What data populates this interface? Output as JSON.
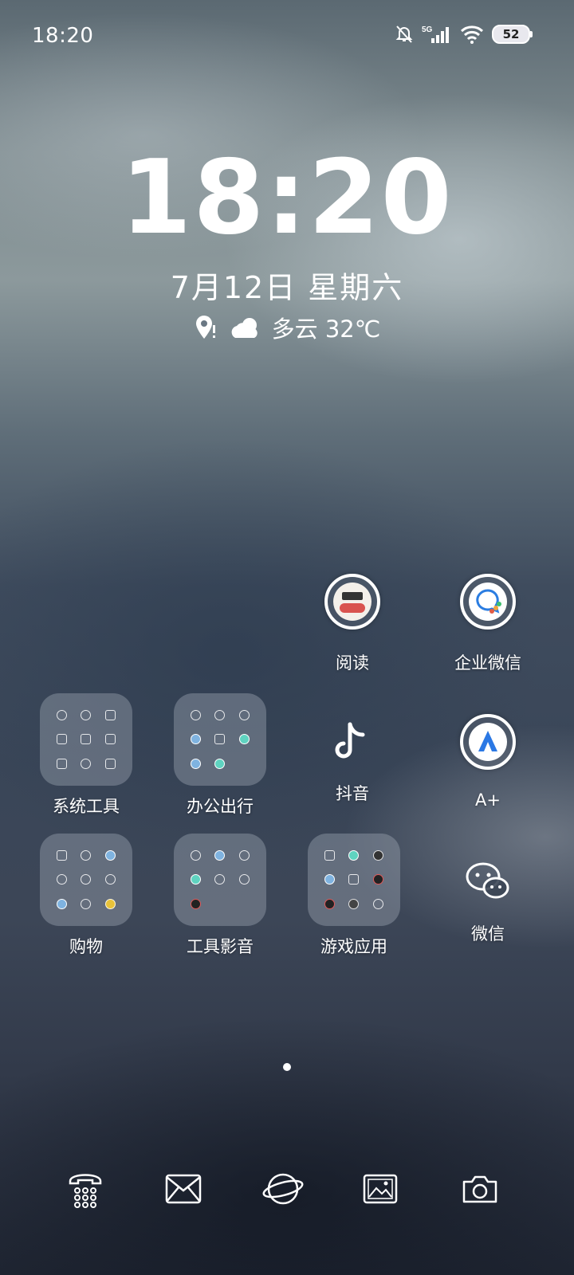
{
  "status_bar": {
    "time": "18:20",
    "network": "5G",
    "battery": "52"
  },
  "lockscreen": {
    "clock": "18:20",
    "date": "7月12日 星期六",
    "weather": "多云 32℃"
  },
  "apps": [
    {
      "label": "阅读",
      "icon": "reading-app-icon"
    },
    {
      "label": "企业微信",
      "icon": "wecom-icon"
    },
    {
      "label": "抖音",
      "icon": "douyin-icon"
    },
    {
      "label": "A+",
      "icon": "a-plus-icon"
    },
    {
      "label": "微信",
      "icon": "wechat-icon"
    }
  ],
  "folders": [
    {
      "label": "系统工具"
    },
    {
      "label": "办公出行"
    },
    {
      "label": "购物"
    },
    {
      "label": "工具影音"
    },
    {
      "label": "游戏应用"
    }
  ],
  "dock": [
    "phone-icon",
    "mail-icon",
    "browser-icon",
    "gallery-icon",
    "camera-icon"
  ]
}
